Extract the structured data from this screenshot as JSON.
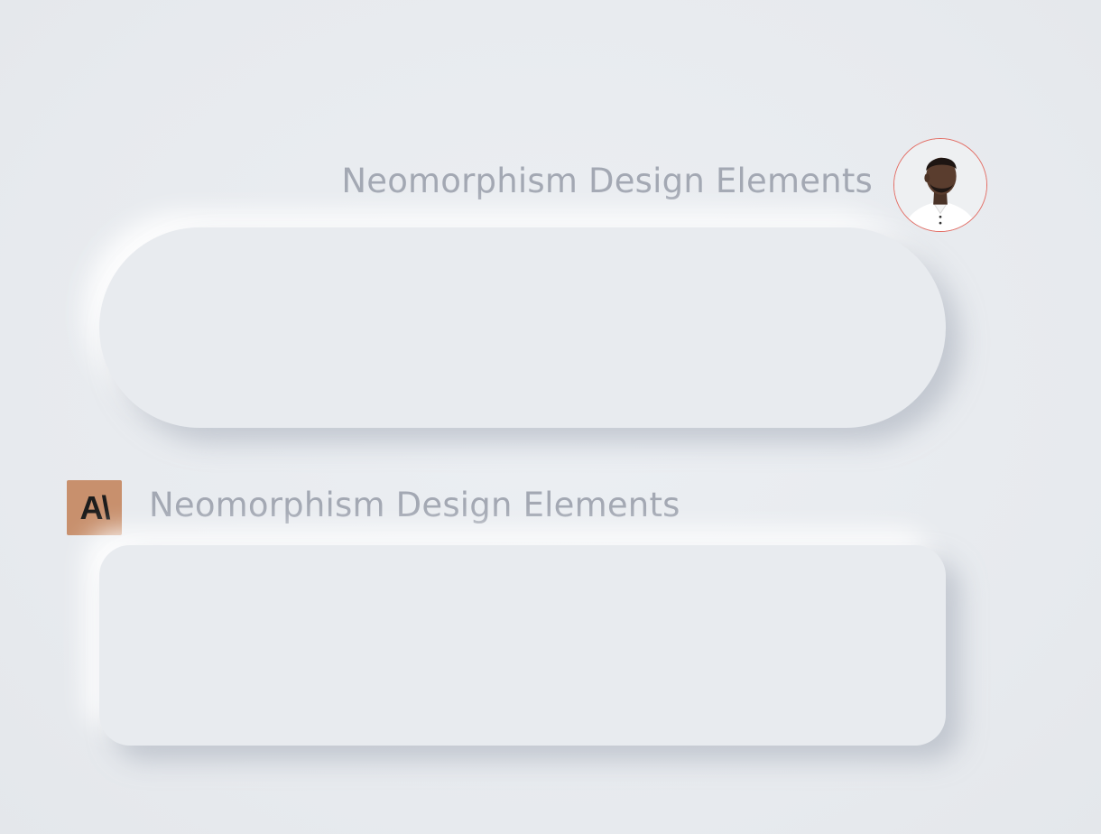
{
  "section_one": {
    "title": "Neomorphism Design Elements"
  },
  "section_two": {
    "title": "Neomorphism Design Elements",
    "logo_text": "A\\"
  },
  "icons": {
    "avatar": "user-avatar-photo",
    "logo": "brand-logo-icon"
  },
  "colors": {
    "background": "#e8ebef",
    "heading_text": "#a3a8b3",
    "avatar_ring": "#e36b62",
    "logo_bg": "#c8906d"
  }
}
